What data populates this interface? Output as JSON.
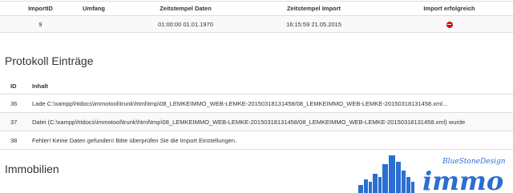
{
  "import_table": {
    "headers": {
      "import_id": "ImportID",
      "umfang": "Umfang",
      "zeitstempel_daten": "Zeitstempel Daten",
      "zeitstempel_import": "Zeitstempel Import",
      "import_erfolgreich": "Import erfolgreich"
    },
    "row": {
      "import_id": "9",
      "umfang": "",
      "zeitstempel_daten": "01:00:00 01.01.1970",
      "zeitstempel_import": "16:15:59 21.05.2015",
      "status_icon": "error-icon",
      "status_color": "#cc1111"
    }
  },
  "protokoll": {
    "title": "Protokoll Einträge",
    "headers": {
      "id": "ID",
      "inhalt": "Inhalt"
    },
    "rows": [
      {
        "id": "36",
        "text": "Lade C:\\xampp\\htdocs\\immotool\\trunk\\html\\tmp\\08_LEMKEIMMO_WEB-LEMKE-20150318131458/08_LEMKEIMMO_WEB-LEMKE-20150318131458.xml..."
      },
      {
        "id": "37",
        "text": "Datei (C:\\xampp\\htdocs\\immotool\\trunk\\html\\tmp\\08_LEMKEIMMO_WEB-LEMKE-20150318131458/08_LEMKEIMMO_WEB-LEMKE-20150318131458.xml) wurde"
      },
      {
        "id": "38",
        "text": "Fehler! Keine Daten gefunden! Bitte überprüfen Sie die Import Einstellungen."
      }
    ]
  },
  "immobilien": {
    "title": "Immobilien"
  },
  "logo": {
    "brand": "immo",
    "tagline": "BlueStoneDesign",
    "color": "#2a6fd1"
  }
}
